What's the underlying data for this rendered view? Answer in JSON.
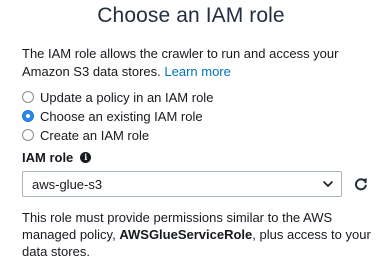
{
  "header": {
    "title": "Choose an IAM role"
  },
  "intro": {
    "text": "The IAM role allows the crawler to run and access your Amazon S3 data stores.",
    "link_label": "Learn more"
  },
  "role_options": [
    {
      "label": "Update a policy in an IAM role",
      "checked": false
    },
    {
      "label": "Choose an existing IAM role",
      "checked": true
    },
    {
      "label": "Create an IAM role",
      "checked": false
    }
  ],
  "iam_role": {
    "label": "IAM role",
    "info_icon": "info-icon",
    "selected_value": "aws-glue-s3",
    "refresh_icon": "refresh-icon"
  },
  "note": {
    "prefix": "This role must provide permissions similar to the AWS managed policy, ",
    "policy_name": "AWSGlueServiceRole",
    "suffix": ", plus access to your data stores."
  },
  "colors": {
    "link": "#0073bb",
    "radio_checked": "#2e86e6",
    "border": "#aab7b8",
    "text": "#16191f"
  }
}
